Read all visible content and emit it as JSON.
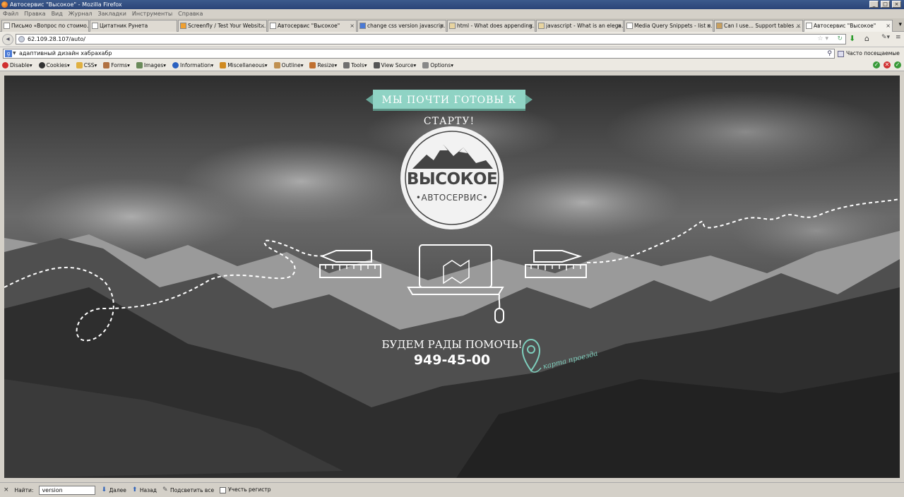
{
  "window": {
    "title": "Автосервис \"Высокое\" - Mozilla Firefox"
  },
  "menu": [
    "Файл",
    "Правка",
    "Вид",
    "Журнал",
    "Закладки",
    "Инструменты",
    "Справка"
  ],
  "tabs": [
    {
      "label": "Письмо «Вопрос по стоимо..."
    },
    {
      "label": "Цитатник Рунета"
    },
    {
      "label": "Screenfly / Test Your Websit..."
    },
    {
      "label": "Автосервис \"Высокое\""
    },
    {
      "label": "change css version javascrip..."
    },
    {
      "label": "html - What does appending..."
    },
    {
      "label": "javascript - What is an elega..."
    },
    {
      "label": "Media Query Snippets - list o..."
    },
    {
      "label": "Can I use... Support tables ..."
    },
    {
      "label": "Автосервис \"Высокое\""
    }
  ],
  "nav": {
    "url": "62.109.28.107/auto/"
  },
  "search": {
    "value": "адаптивный дизайн хабрахабр",
    "bookmark": "Часто посещаемые"
  },
  "devbar": [
    "Disable",
    "Cookies",
    "CSS",
    "Forms",
    "Images",
    "Information",
    "Miscellaneous",
    "Outline",
    "Resize",
    "Tools",
    "View Source",
    "Options"
  ],
  "page": {
    "banner": "МЫ ПОЧТИ ГОТОВЫ К СТАРТУ!",
    "logo_title": "ВЫСОКОЕ",
    "logo_sub": "•АВТОСЕРВИС•",
    "help": "БУДЕМ РАДЫ ПОМОЧЬ!",
    "phone": "949-45-00",
    "map_link": "карта проезда"
  },
  "find": {
    "label": "Найти:",
    "value": "version",
    "next": "Далее",
    "prev": "Назад",
    "highlight": "Подсветить все",
    "matchcase": "Учесть регистр"
  },
  "colors": {
    "accent": "#7ecfbd",
    "banner": "#8fd3c4"
  }
}
